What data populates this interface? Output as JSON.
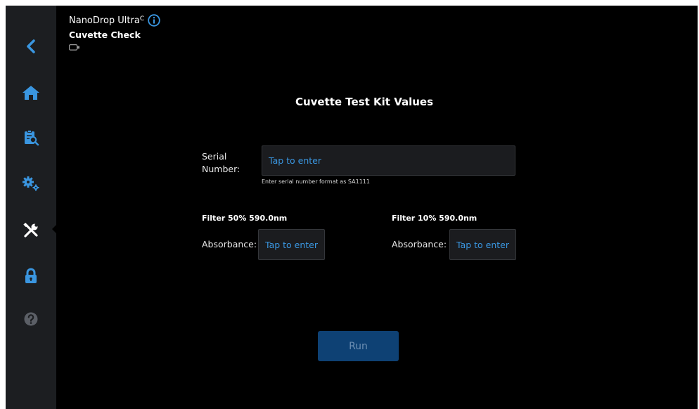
{
  "header": {
    "app_name": "NanoDrop Ultra",
    "app_suffix": "C",
    "page_title": "Cuvette Check"
  },
  "sidebar": {
    "items": [
      {
        "name": "back",
        "icon": "chevron-left-icon"
      },
      {
        "name": "home",
        "icon": "home-icon"
      },
      {
        "name": "data-viewer",
        "icon": "clipboard-search-icon"
      },
      {
        "name": "settings",
        "icon": "gears-icon"
      },
      {
        "name": "diagnostics",
        "icon": "tools-icon",
        "active": true
      },
      {
        "name": "security",
        "icon": "lock-icon"
      },
      {
        "name": "help",
        "icon": "help-icon"
      }
    ]
  },
  "main": {
    "section_title": "Cuvette Test Kit Values",
    "serial": {
      "label": "Serial\nNumber:",
      "placeholder": "Tap to enter",
      "hint": "Enter serial number format as SA1111"
    },
    "filter_50": {
      "title": "Filter 50% 590.0nm",
      "absorbance_label": "Absorbance:",
      "placeholder": "Tap to enter"
    },
    "filter_10": {
      "title": "Filter 10% 590.0nm",
      "absorbance_label": "Absorbance:",
      "placeholder": "Tap to enter"
    },
    "run_label": "Run"
  },
  "colors": {
    "background": "#000000",
    "sidebar": "#1c1e21",
    "accent_blue": "#3a96e0",
    "run_button_disabled": "#0e4174"
  }
}
